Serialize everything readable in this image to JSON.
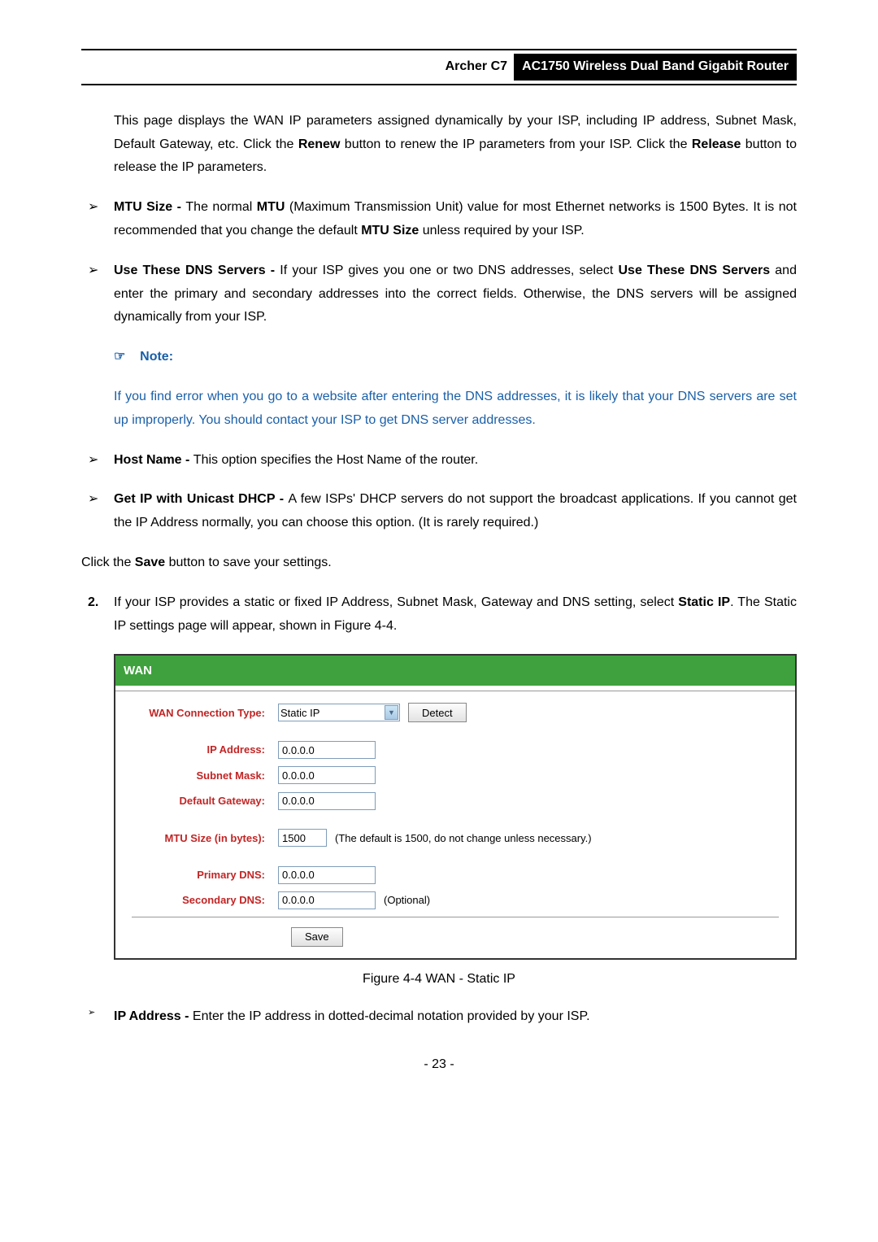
{
  "header": {
    "archer": "Archer C7",
    "title": "AC1750 Wireless Dual Band Gigabit Router"
  },
  "para1": {
    "prefix": "This page displays the WAN IP parameters assigned dynamically by your ISP, including IP address, Subnet Mask, Default Gateway, etc. Click the ",
    "renew": "Renew",
    "mid": " button to renew the IP parameters from your ISP. Click the ",
    "release": "Release",
    "suffix": " button to release the IP parameters."
  },
  "bullets": {
    "mtu": {
      "label": "MTU Size - ",
      "t1": "The normal ",
      "mtu_bold": "MTU",
      "t2": " (Maximum Transmission Unit) value for most Ethernet networks is 1500 Bytes. It is not recommended that you change the default ",
      "mtu_size_bold": "MTU Size",
      "t3": " unless required by your ISP."
    },
    "dns": {
      "label": "Use These DNS Servers - ",
      "t1": "If your ISP gives you one or two DNS addresses, select ",
      "use_bold": "Use These DNS Servers",
      "t2": " and enter the primary and secondary addresses into the correct fields. Otherwise, the DNS servers will be assigned dynamically from your ISP."
    },
    "host": {
      "label": "Host Name - ",
      "text": "This option specifies the Host Name of the router."
    },
    "unicast": {
      "label": "Get IP with Unicast DHCP - ",
      "text": "A few ISPs' DHCP servers do not support the broadcast applications. If you cannot get the IP Address normally, you can choose this option. (It is rarely required.)"
    },
    "ipaddr": {
      "label": "IP Address - ",
      "text": "Enter the IP address in dotted-decimal notation provided by your ISP."
    }
  },
  "note": {
    "icon": "☞",
    "label": "Note:",
    "text": "If you find error when you go to a website after entering the DNS addresses, it is likely that your DNS servers are set up improperly. You should contact your ISP to get DNS server addresses."
  },
  "save_line": {
    "t1": "Click the ",
    "save_bold": "Save",
    "t2": " button to save your settings."
  },
  "ol2": {
    "num": "2.",
    "t1": "If your ISP provides a static or fixed IP Address, Subnet Mask, Gateway and DNS setting, select ",
    "static_bold": "Static IP",
    "t2": ". The Static IP settings page will appear, shown in Figure 4-4."
  },
  "wan": {
    "title": "WAN",
    "labels": {
      "conn_type": "WAN Connection Type:",
      "ip": "IP Address:",
      "subnet": "Subnet Mask:",
      "gateway": "Default Gateway:",
      "mtu": "MTU Size (in bytes):",
      "primary": "Primary DNS:",
      "secondary": "Secondary DNS:"
    },
    "values": {
      "conn_type": "Static IP",
      "ip": "0.0.0.0",
      "subnet": "0.0.0.0",
      "gateway": "0.0.0.0",
      "mtu": "1500",
      "primary": "0.0.0.0",
      "secondary": "0.0.0.0"
    },
    "buttons": {
      "detect": "Detect",
      "save": "Save"
    },
    "hints": {
      "mtu": "(The default is 1500, do not change unless necessary.)",
      "secondary": "(Optional)"
    }
  },
  "figure_caption": "Figure 4-4 WAN - Static IP",
  "page_number": "- 23 -",
  "glyphs": {
    "triangle": "➢"
  }
}
